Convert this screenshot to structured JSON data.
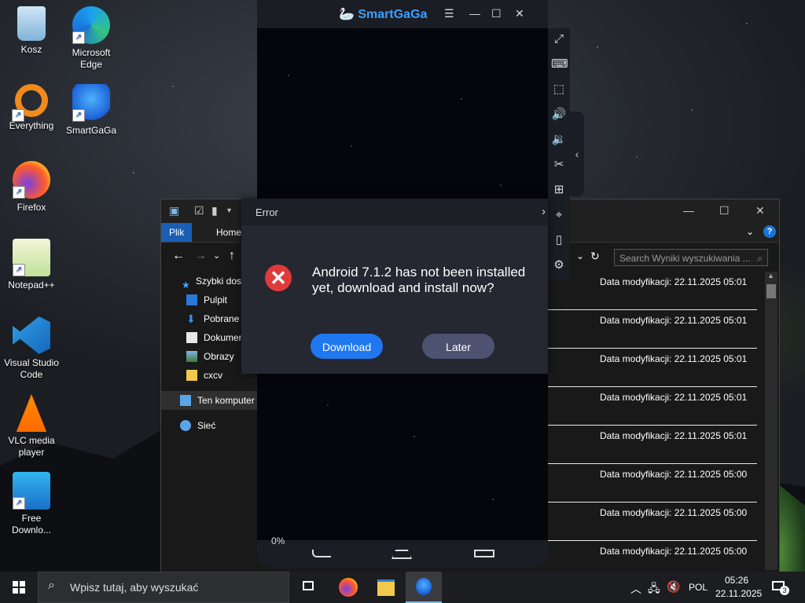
{
  "desktop": {
    "icons": [
      {
        "label": "Kosz"
      },
      {
        "label": "Microsoft Edge"
      },
      {
        "label": "Everything"
      },
      {
        "label": "SmartGaGa"
      },
      {
        "label": "Firefox"
      },
      {
        "label": "Notepad++"
      },
      {
        "label": "Visual Studio Code"
      },
      {
        "label": "VLC media player"
      },
      {
        "label": "Free Downlo..."
      }
    ]
  },
  "emulator": {
    "title": "SmartGaGa",
    "progress": "0%"
  },
  "dialog": {
    "title": "Error",
    "message": "Android 7.1.2 has not been installed yet, download and install now?",
    "download_label": "Download",
    "later_label": "Later"
  },
  "explorer": {
    "ribbon_tabs": [
      "Plik",
      "Home"
    ],
    "search_placeholder": "Search Wyniki wyszukiwania ...",
    "tree": [
      {
        "label": "Szybki dostęp"
      },
      {
        "label": "Pulpit"
      },
      {
        "label": "Pobrane"
      },
      {
        "label": "Dokumenty"
      },
      {
        "label": "Obrazy"
      },
      {
        "label": "cxcv"
      },
      {
        "label": "Ten komputer"
      },
      {
        "label": "Sieć"
      }
    ],
    "results": [
      {
        "text": "Data modyfikacji: 22.11.2025 05:01"
      },
      {
        "text": "Data modyfikacji: 22.11.2025 05:01"
      },
      {
        "text": "Data modyfikacji: 22.11.2025 05:01"
      },
      {
        "text": "Data modyfikacji: 22.11.2025 05:01"
      },
      {
        "text": "Data modyfikacji: 22.11.2025 05:01"
      },
      {
        "text": "Data modyfikacji: 22.11.2025 05:00"
      },
      {
        "text": "Data modyfikacji: 22.11.2025 05:00"
      },
      {
        "text": "Data modyfikacji: 22.11.2025 05:00"
      }
    ]
  },
  "taskbar": {
    "search_placeholder": "Wpisz tutaj, aby wyszukać",
    "language": "POL",
    "time": "05:26",
    "date": "22.11.2025",
    "notification_count": "3"
  }
}
